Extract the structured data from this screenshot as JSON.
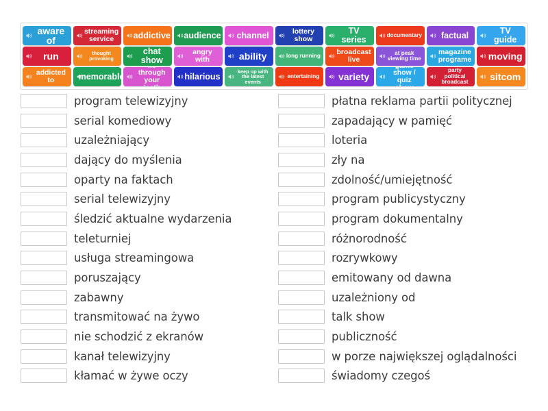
{
  "app": {
    "type": "match-up-vocabulary-exercise",
    "language_pair": "English-Polish"
  },
  "tile_bank": {
    "icon": "speaker-icon",
    "rows": [
      [
        {
          "label": "aware of",
          "color": "#2a9fd8",
          "size": "w-s",
          "fs": "fs-lg"
        },
        {
          "label": "streaming service",
          "color": "#d32836",
          "size": "w-s",
          "fs": "fs-sm"
        },
        {
          "label": "addictive",
          "color": "#f5741a",
          "size": "w-s",
          "fs": "fs-md"
        },
        {
          "label": "audience",
          "color": "#1f9c52",
          "size": "w-s",
          "fs": "fs-md"
        },
        {
          "label": "channel",
          "color": "#e055d4",
          "size": "w-s",
          "fs": "fs-md"
        },
        {
          "label": "lottery show",
          "color": "#2340b0",
          "size": "w-s",
          "fs": "fs-sm"
        },
        {
          "label": "TV series",
          "color": "#2ab06a",
          "size": "w-s",
          "fs": "fs-md"
        },
        {
          "label": "documentary",
          "color": "#ee3a1c",
          "size": "w-s",
          "fs": "fs-xs"
        },
        {
          "label": "factual",
          "color": "#8a46d0",
          "size": "w-s",
          "fs": "fs-md"
        },
        {
          "label": "TV guide",
          "color": "#35a5ee",
          "size": "w-s",
          "fs": "fs-md"
        }
      ],
      [
        {
          "label": "run",
          "color": "#d81f3c",
          "size": "w-s",
          "fs": "fs-lg"
        },
        {
          "label": "thought provoking",
          "color": "#f5871f",
          "size": "w-s",
          "fs": "fs-xxs"
        },
        {
          "label": "chat show",
          "color": "#1d9e4e",
          "size": "w-s",
          "fs": "fs-md"
        },
        {
          "label": "angry with",
          "color": "#de5fd6",
          "size": "w-s",
          "fs": "fs-sm"
        },
        {
          "label": "ability",
          "color": "#2040c8",
          "size": "w-s",
          "fs": "fs-lg"
        },
        {
          "label": "long running",
          "color": "#44b578",
          "size": "w-s",
          "fs": "fs-xs"
        },
        {
          "label": "broadcast live",
          "color": "#f04a1a",
          "size": "w-s",
          "fs": "fs-sm"
        },
        {
          "label": "at peak viewing time",
          "color": "#8a55d8",
          "size": "w-s",
          "fs": "fs-xs"
        },
        {
          "label": "magazine programe",
          "color": "#2aa6e0",
          "size": "w-s",
          "fs": "fs-sm"
        },
        {
          "label": "moving",
          "color": "#d42030",
          "size": "w-s",
          "fs": "fs-lg"
        }
      ],
      [
        {
          "label": "addicted to",
          "color": "#f5821f",
          "size": "w-s",
          "fs": "fs-sm"
        },
        {
          "label": "memorable",
          "color": "#1fa35a",
          "size": "w-s",
          "fs": "fs-md"
        },
        {
          "label": "lie through your teeth",
          "color": "#d955cf",
          "size": "w-s",
          "fs": "fs-sm"
        },
        {
          "label": "hilarious",
          "color": "#2230c8",
          "size": "w-s",
          "fs": "fs-md"
        },
        {
          "label": "keep up with the latest events",
          "color": "#49b581",
          "size": "w-s",
          "fs": "fs-xxs"
        },
        {
          "label": "entertaining",
          "color": "#ef3a14",
          "size": "w-s",
          "fs": "fs-xs"
        },
        {
          "label": "variety",
          "color": "#8532d4",
          "size": "w-s",
          "fs": "fs-lg"
        },
        {
          "label": "game show / quiz show",
          "color": "#2aa8e8",
          "size": "w-s",
          "fs": "fs-sm"
        },
        {
          "label": "party political broadcast",
          "color": "#d32034",
          "size": "w-s",
          "fs": "fs-xs"
        },
        {
          "label": "sitcom",
          "color": "#f5881f",
          "size": "w-s",
          "fs": "fs-lg"
        }
      ]
    ]
  },
  "answers": {
    "left": [
      "program telewizyjny",
      "serial komediowy",
      "uzależniający",
      "dający do myślenia",
      "oparty na faktach",
      "serial telewizyjny",
      "śledzić aktualne wydarzenia",
      "teleturniej",
      "usługa streamingowa",
      "poruszający",
      "zabawny",
      "transmitować na żywo",
      "nie schodzić z ekranów",
      "kanał telewizyjny",
      "kłamać w żywe oczy"
    ],
    "right": [
      "płatna reklama partii politycznej",
      "zapadający w pamięć",
      "loteria",
      "zły na",
      "zdolność/umiejętność",
      "program publicystyczny",
      "program dokumentalny",
      "różnorodność",
      "rozrywkowy",
      "emitowany od dawna",
      "uzależniony od",
      "talk show",
      "publiczność",
      "w porze największej oglądalności",
      "świadomy czegoś"
    ]
  }
}
